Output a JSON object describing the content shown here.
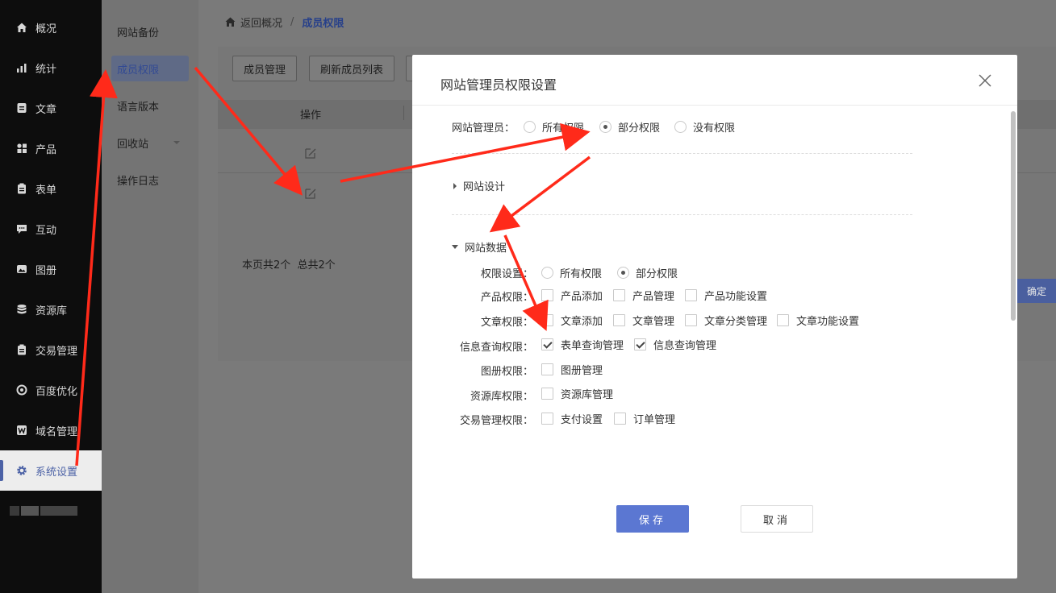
{
  "sidebar": {
    "items": [
      {
        "label": "概况",
        "icon": "home-icon"
      },
      {
        "label": "统计",
        "icon": "chart-icon"
      },
      {
        "label": "文章",
        "icon": "article-icon"
      },
      {
        "label": "产品",
        "icon": "grid-icon"
      },
      {
        "label": "表单",
        "icon": "clipboard-icon"
      },
      {
        "label": "互动",
        "icon": "chat-icon"
      },
      {
        "label": "图册",
        "icon": "image-icon"
      },
      {
        "label": "资源库",
        "icon": "database-icon"
      },
      {
        "label": "交易管理",
        "icon": "clipboard-icon"
      },
      {
        "label": "百度优化",
        "icon": "target-icon"
      },
      {
        "label": "域名管理",
        "icon": "w-icon"
      },
      {
        "label": "系统设置",
        "icon": "gear-icon",
        "active": true
      }
    ]
  },
  "submenu": {
    "items": [
      {
        "label": "网站备份"
      },
      {
        "label": "成员权限",
        "active": true
      },
      {
        "label": "语言版本"
      },
      {
        "label": "回收站"
      },
      {
        "label": "操作日志"
      }
    ]
  },
  "breadcrumb": {
    "back": "返回概况",
    "sep": "/",
    "current": "成员权限"
  },
  "toolbar": {
    "member_manage": "成员管理",
    "refresh_list": "刷新成员列表"
  },
  "table": {
    "op_header": "操作",
    "footer": "本页共2个  总共2个"
  },
  "confirm_peek": "确定",
  "modal": {
    "title": "网站管理员权限设置",
    "admin_label": "网站管理员：",
    "admin_options": [
      {
        "label": "所有权限",
        "checked": false
      },
      {
        "label": "部分权限",
        "checked": true
      },
      {
        "label": "没有权限",
        "checked": false
      }
    ],
    "section_design": "网站设计",
    "section_data": "网站数据",
    "rows": [
      {
        "label": "权限设置：",
        "type": "radio",
        "options": [
          {
            "label": "所有权限",
            "checked": false
          },
          {
            "label": "部分权限",
            "checked": true
          }
        ]
      },
      {
        "label": "产品权限：",
        "type": "checkbox",
        "options": [
          {
            "label": "产品添加",
            "checked": false
          },
          {
            "label": "产品管理",
            "checked": false
          },
          {
            "label": "产品功能设置",
            "checked": false
          }
        ]
      },
      {
        "label": "文章权限：",
        "type": "checkbox",
        "options": [
          {
            "label": "文章添加",
            "checked": false
          },
          {
            "label": "文章管理",
            "checked": false
          },
          {
            "label": "文章分类管理",
            "checked": false
          },
          {
            "label": "文章功能设置",
            "checked": false
          }
        ]
      },
      {
        "label": "信息查询权限：",
        "type": "checkbox",
        "options": [
          {
            "label": "表单查询管理",
            "checked": true
          },
          {
            "label": "信息查询管理",
            "checked": true
          }
        ]
      },
      {
        "label": "图册权限：",
        "type": "checkbox",
        "options": [
          {
            "label": "图册管理",
            "checked": false
          }
        ]
      },
      {
        "label": "资源库权限：",
        "type": "checkbox",
        "options": [
          {
            "label": "资源库管理",
            "checked": false
          }
        ]
      },
      {
        "label": "交易管理权限：",
        "type": "checkbox",
        "options": [
          {
            "label": "支付设置",
            "checked": false
          },
          {
            "label": "订单管理",
            "checked": false
          }
        ]
      }
    ],
    "save": "保存",
    "cancel": "取消"
  },
  "colors": {
    "accent": "#5b77d2",
    "annotation": "#ff2a1a"
  }
}
